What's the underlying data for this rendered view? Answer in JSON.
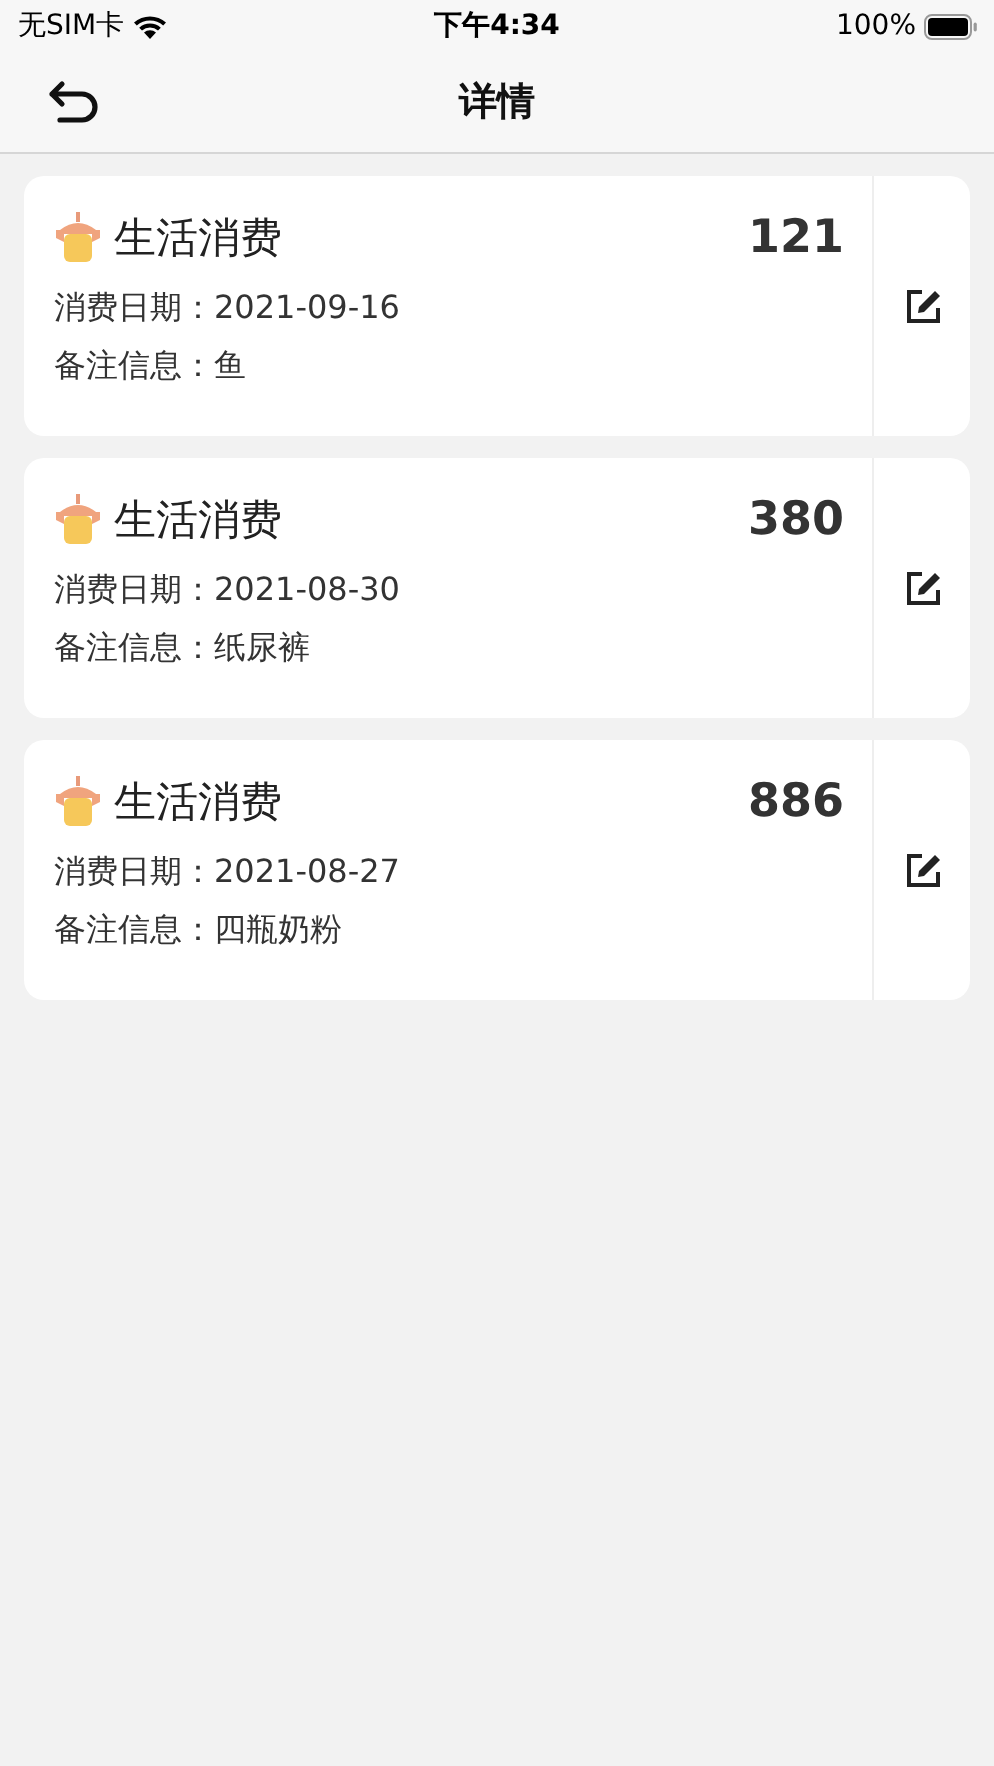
{
  "status_bar": {
    "carrier": "无SIM卡",
    "time": "下午4:34",
    "battery": "100%"
  },
  "nav": {
    "title": "详情"
  },
  "records": [
    {
      "category": "生活消费",
      "amount": "121",
      "date_line": "消费日期：2021-09-16",
      "note_line": "备注信息：鱼"
    },
    {
      "category": "生活消费",
      "amount": "380",
      "date_line": "消费日期：2021-08-30",
      "note_line": "备注信息：纸尿裤"
    },
    {
      "category": "生活消费",
      "amount": "886",
      "date_line": "消费日期：2021-08-27",
      "note_line": "备注信息：四瓶奶粉"
    }
  ]
}
